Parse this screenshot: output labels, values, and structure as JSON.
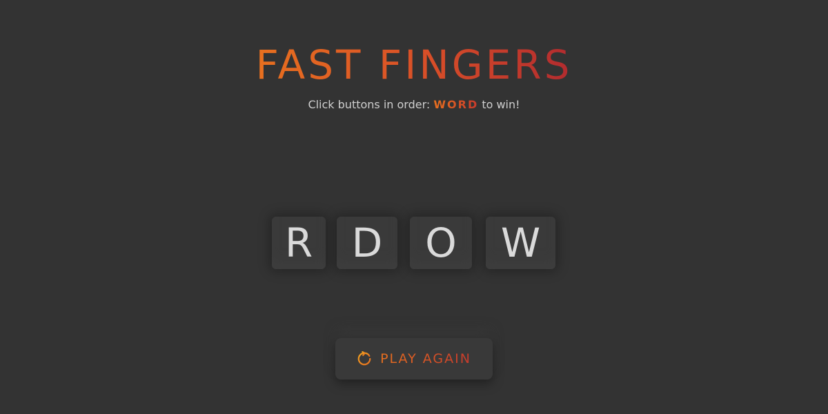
{
  "title": "FAST FINGERS",
  "instructions": {
    "prefix": "Click buttons in order: ",
    "word": "WORD",
    "suffix": " to win!"
  },
  "keys": [
    {
      "letter": "R"
    },
    {
      "letter": "D"
    },
    {
      "letter": "O"
    },
    {
      "letter": "W"
    }
  ],
  "play_again": {
    "icon": "refresh-icon",
    "label": "PLAY AGAIN"
  },
  "colors": {
    "background": "#333333",
    "accent_start": "#e8701f",
    "accent_end": "#b22b2f",
    "key_face": "#3a3a3a",
    "key_text": "#dadada"
  }
}
